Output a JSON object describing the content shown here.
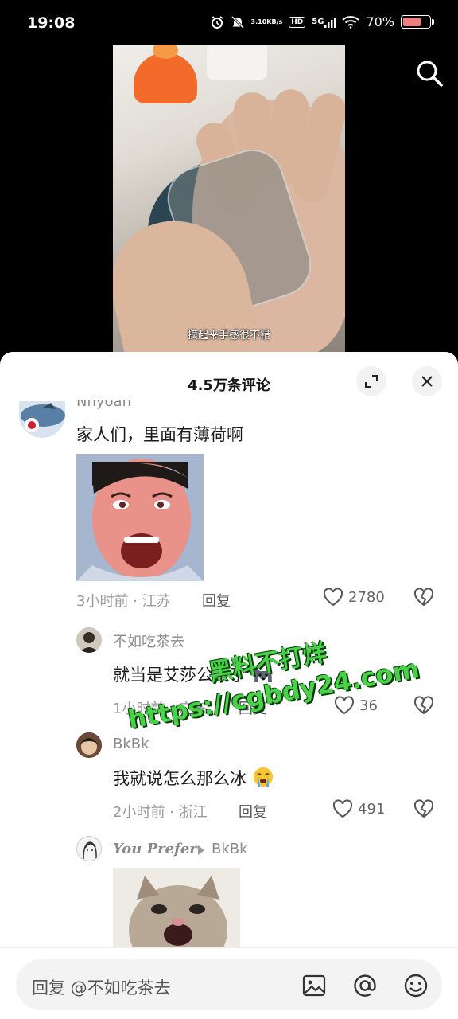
{
  "status_bar": {
    "time": "19:08",
    "net_speed_top": "3.10",
    "net_speed_bottom": "KB/s",
    "hd": "HD",
    "network": "5G",
    "battery": "70%",
    "battery_level": 0.7
  },
  "video": {
    "subtitle": "摸起来手感很不错"
  },
  "comments_panel": {
    "title": "4.5万条评论"
  },
  "comments": [
    {
      "username": "Nnyoan",
      "text": "家人们，里面有薄荷啊",
      "meta": "3小时前 · 江苏",
      "reply": "回复",
      "likes": "2780"
    },
    {
      "username": "不如吃茶去",
      "text": "就当是艾莎公主了",
      "meta": "1小时前 · 广东",
      "reply": "回复",
      "likes": "36"
    },
    {
      "username": "BkBk",
      "text": "我就说怎么那么冰",
      "meta": "2小时前 · 浙江",
      "reply": "回复",
      "likes": "491"
    },
    {
      "username": "You Prefer",
      "reply_to": "BkBk"
    }
  ],
  "watermark": {
    "line1": "黑料不打烊",
    "line2": "https://cgbdy24.com"
  },
  "input": {
    "placeholder": "回复 @不如吃茶去"
  },
  "colors": {
    "watermark": "#4ad14a",
    "sheet_bg": "#ffffff",
    "heart_stroke": "#555555"
  }
}
